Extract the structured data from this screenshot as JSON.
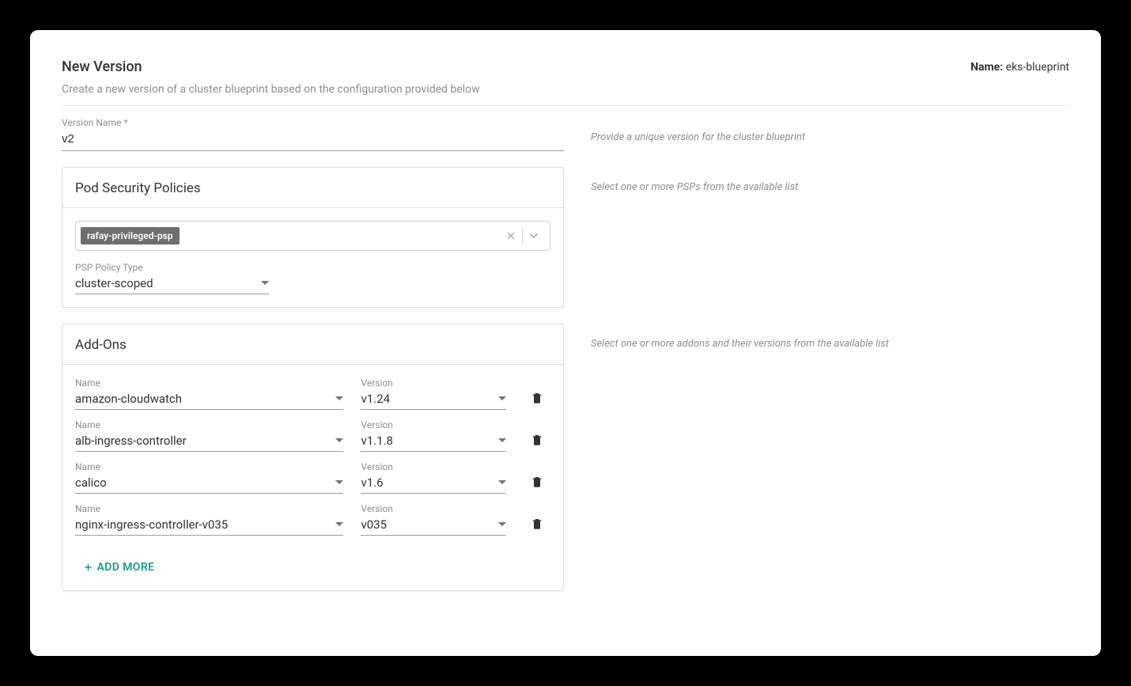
{
  "header": {
    "title": "New Version",
    "subtitle": "Create a new version of a cluster blueprint based on the configuration provided below",
    "name_label": "Name:",
    "name_value": "eks-blueprint"
  },
  "version": {
    "label": "Version Name *",
    "value": "v2",
    "hint": "Provide a unique version for the cluster blueprint"
  },
  "psp": {
    "title": "Pod Security Policies",
    "hint": "Select one or more PSPs from the available list",
    "selected_chip": "rafay-privileged-psp",
    "policy_type_label": "PSP Policy Type",
    "policy_type_value": "cluster-scoped"
  },
  "addons": {
    "title": "Add-Ons",
    "hint": "Select one or more addons and their versions from the available list",
    "name_label": "Name",
    "version_label": "Version",
    "rows": [
      {
        "name": "amazon-cloudwatch",
        "version": "v1.24"
      },
      {
        "name": "alb-ingress-controller",
        "version": "v1.1.8"
      },
      {
        "name": "calico",
        "version": "v1.6"
      },
      {
        "name": "nginx-ingress-controller-v035",
        "version": "v035"
      }
    ],
    "add_more_label": "ADD MORE"
  }
}
